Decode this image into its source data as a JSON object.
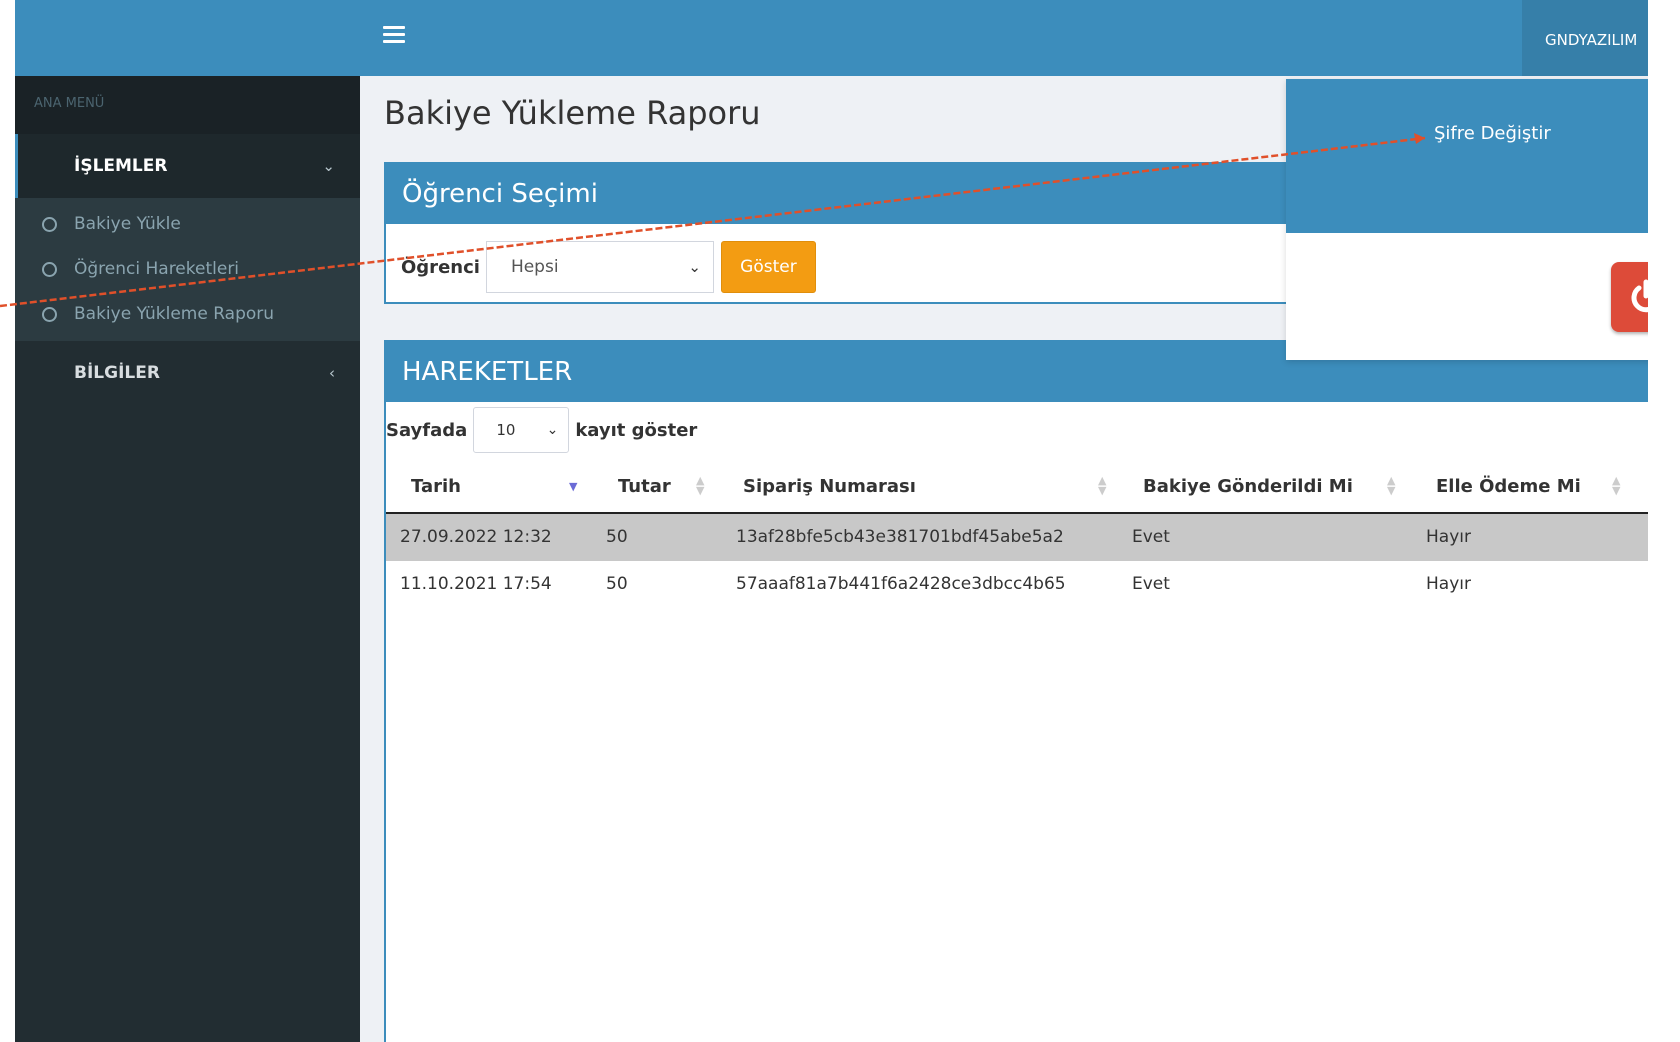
{
  "header": {
    "user_name": "GNDYAZILIM",
    "menu_icon": "hamburger-icon"
  },
  "sidebar": {
    "header": "ANA MENÜ",
    "sections": [
      {
        "label": "İŞLEMLER",
        "caret": "⌄",
        "expanded": true
      },
      {
        "label": "BİLGİLER",
        "caret": "‹",
        "expanded": false
      }
    ],
    "items": [
      {
        "label": "Bakiye Yükle"
      },
      {
        "label": "Öğrenci Hareketleri"
      },
      {
        "label": "Bakiye Yükleme Raporu"
      }
    ]
  },
  "page": {
    "title": "Bakiye Yükleme Raporu"
  },
  "student_box": {
    "title": "Öğrenci Seçimi",
    "label": "Öğrenci",
    "selected": "Hepsi",
    "button": "Göster"
  },
  "moves_box": {
    "title": "HAREKETLER",
    "length_prefix": "Sayfada",
    "length_value": "10",
    "length_suffix": "kayıt göster",
    "columns": [
      "Tarih",
      "Tutar",
      "Sipariş Numarası",
      "Bakiye Gönderildi Mi",
      "Elle Ödeme Mi"
    ],
    "rows": [
      [
        "27.09.2022 12:32",
        "50",
        "13af28bfe5cb43e381701bdf45abe5a2",
        "Evet",
        "Hayır"
      ],
      [
        "11.10.2021 17:54",
        "50",
        "57aaaf81a7b441f6a2428ce3dbcc4b65",
        "Evet",
        "Hayır"
      ]
    ]
  },
  "user_dropdown": {
    "change_password": "Şifre Değiştir",
    "logout_icon": "power-icon",
    "logout_color": "#dd4b39"
  },
  "colors": {
    "primary": "#3c8dbc",
    "sidebar": "#222d32",
    "warning": "#f39c12",
    "annotation": "#e0502a"
  }
}
